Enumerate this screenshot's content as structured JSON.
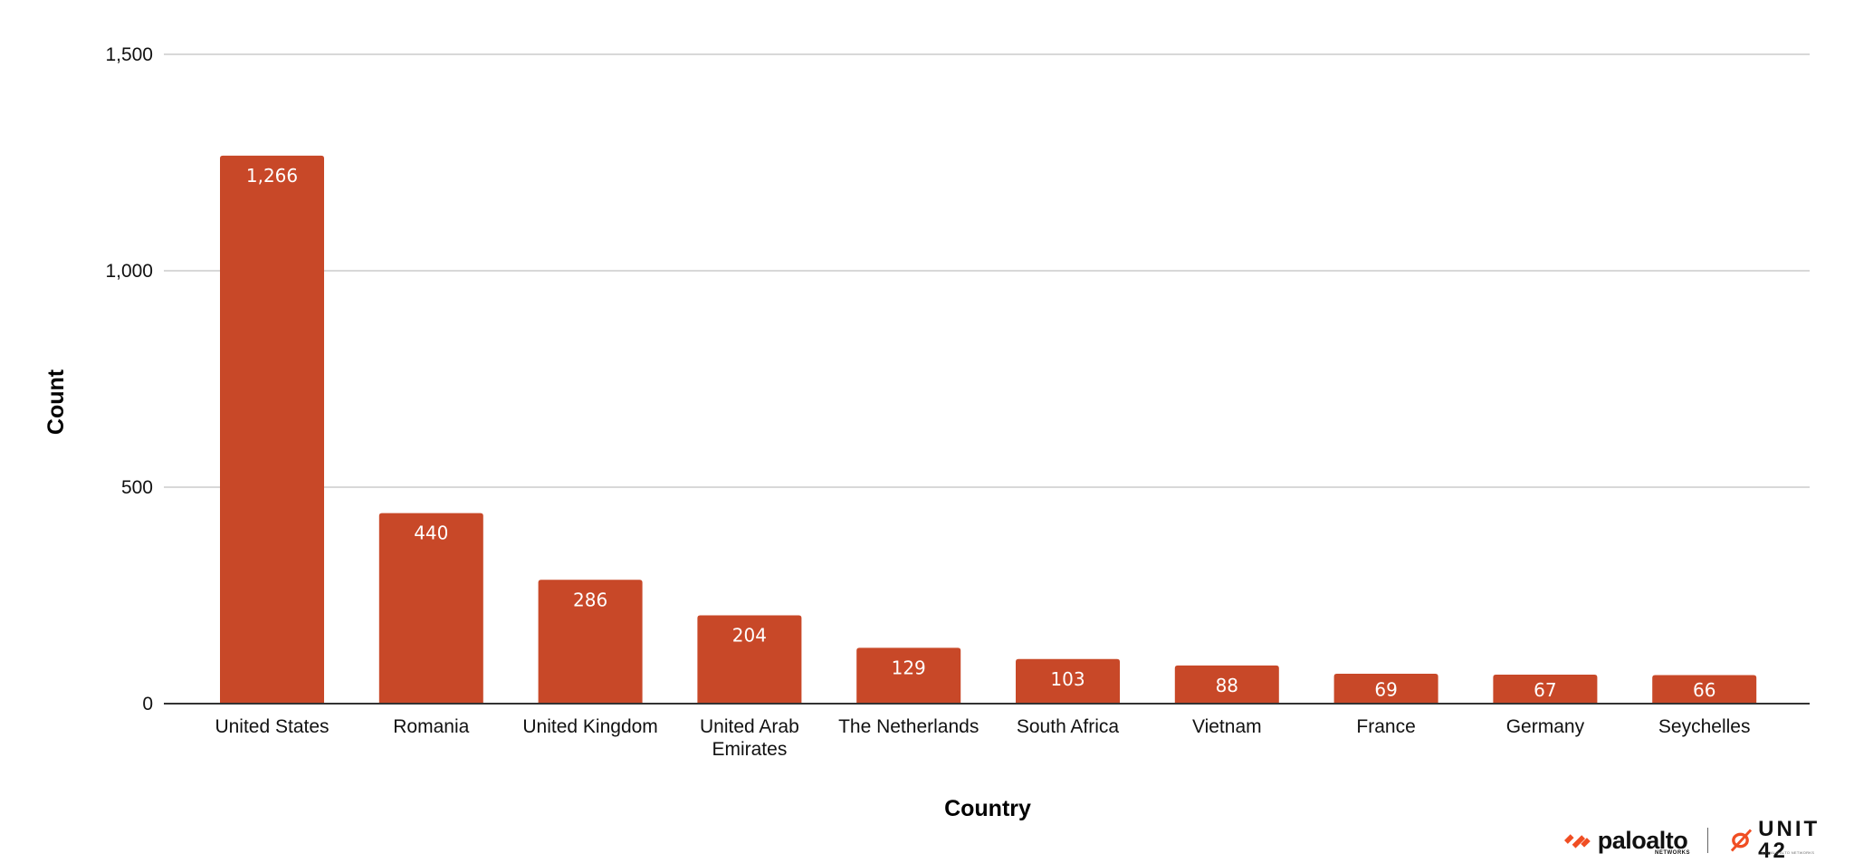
{
  "chart_data": {
    "type": "bar",
    "title": "",
    "xlabel": "Country",
    "ylabel": "Count",
    "categories": [
      "United States",
      "Romania",
      "United Kingdom",
      "United Arab Emirates",
      "The Netherlands",
      "South Africa",
      "Vietnam",
      "France",
      "Germany",
      "Seychelles"
    ],
    "category_lines": [
      [
        "United States"
      ],
      [
        "Romania"
      ],
      [
        "United Kingdom"
      ],
      [
        "United Arab",
        "Emirates"
      ],
      [
        "The Netherlands"
      ],
      [
        "South Africa"
      ],
      [
        "Vietnam"
      ],
      [
        "France"
      ],
      [
        "Germany"
      ],
      [
        "Seychelles"
      ]
    ],
    "values": [
      1266,
      440,
      286,
      204,
      129,
      103,
      88,
      69,
      67,
      66
    ],
    "value_labels": [
      "1,266",
      "440",
      "286",
      "204",
      "129",
      "103",
      "88",
      "69",
      "67",
      "66"
    ],
    "ylim": [
      0,
      1500
    ],
    "yticks": [
      0,
      500,
      1000,
      1500
    ],
    "ytick_labels": [
      "0",
      "500",
      "1,000",
      "1,500"
    ],
    "grid": true,
    "legend": "none",
    "bar_color": "#C84828",
    "data_labels": "inside-top"
  },
  "branding": {
    "paloalto_text": "paloalto",
    "paloalto_sub": "NETWORKS",
    "unit42_text": "UNIT 42",
    "unit42_sub": "BY PALO ALTO NETWORKS",
    "accent": "#F04E23"
  }
}
